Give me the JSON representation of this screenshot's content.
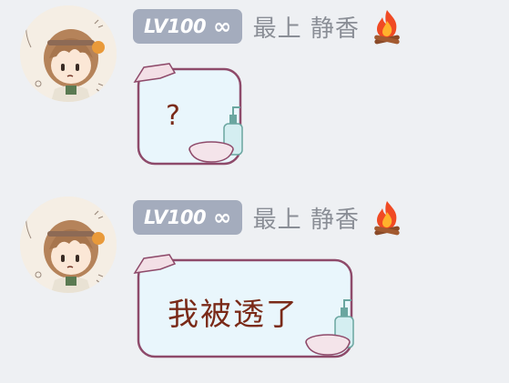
{
  "messages": [
    {
      "sender": {
        "level_badge": "LV100",
        "infinity": "∞",
        "name": "最上 静香",
        "flair_icon": "campfire-icon"
      },
      "text": "?"
    },
    {
      "sender": {
        "level_badge": "LV100",
        "infinity": "∞",
        "name": "最上 静香",
        "flair_icon": "campfire-icon"
      },
      "text": "我被透了"
    }
  ],
  "colors": {
    "background": "#eef0f3",
    "badge": "#a4acbd",
    "name": "#8a8e96",
    "bubble_fill": "#e9f6fc",
    "bubble_border": "#8e4a6a",
    "text": "#7a2a18"
  }
}
